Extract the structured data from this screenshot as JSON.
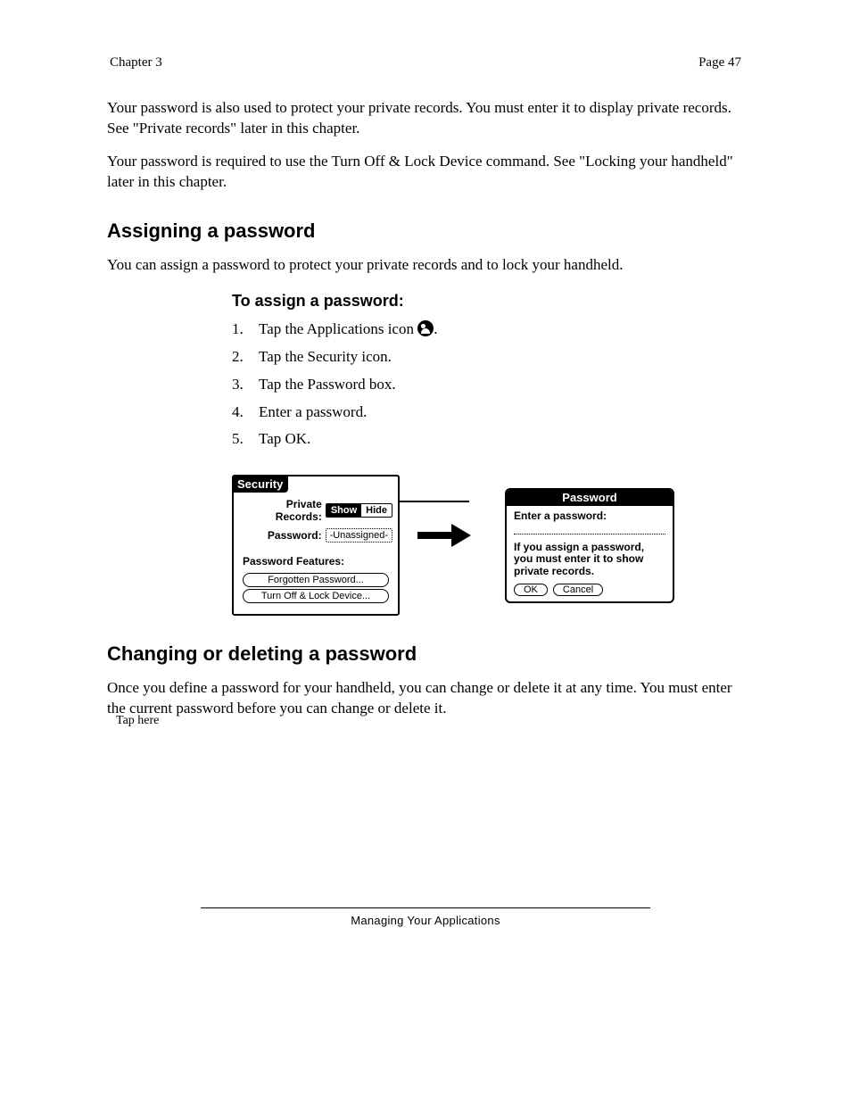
{
  "header": {
    "section": "Chapter 3",
    "page": "Page 47"
  },
  "intro": {
    "p1": "Your password is also used to protect your private records. You must enter it to display private records. See \"Private records\" later in this chapter.",
    "p2": "Your password is required to use the Turn Off & Lock Device command. See \"Locking your handheld\" later in this chapter."
  },
  "assign": {
    "heading": "Assigning a password",
    "p": "You can assign a password to protect your private records and to lock your handheld.",
    "steps_title": "To assign a password:",
    "steps": [
      "Tap the Applications icon ICON.",
      "Tap the Security icon.",
      "Tap the Password box.",
      "Enter a password.",
      "Tap OK."
    ]
  },
  "callout": "Tap here",
  "security_panel": {
    "title": "Security",
    "private_records_label": "Private Records:",
    "toggle": {
      "show": "Show",
      "hide": "Hide"
    },
    "password_label": "Password:",
    "password_value": "-Unassigned-",
    "features_label": "Password Features:",
    "btn_forgotten": "Forgotten Password...",
    "btn_lock": "Turn Off & Lock Device..."
  },
  "password_dialog": {
    "title": "Password",
    "prompt": "Enter a password:",
    "message": "If you assign a password, you must enter it to show private records.",
    "ok": "OK",
    "cancel": "Cancel"
  },
  "change": {
    "heading": "Changing or deleting a password",
    "p": "Once you define a password for your handheld, you can change or delete it at any time. You must enter the current password before you can change or delete it."
  },
  "footer": "Managing Your Applications"
}
